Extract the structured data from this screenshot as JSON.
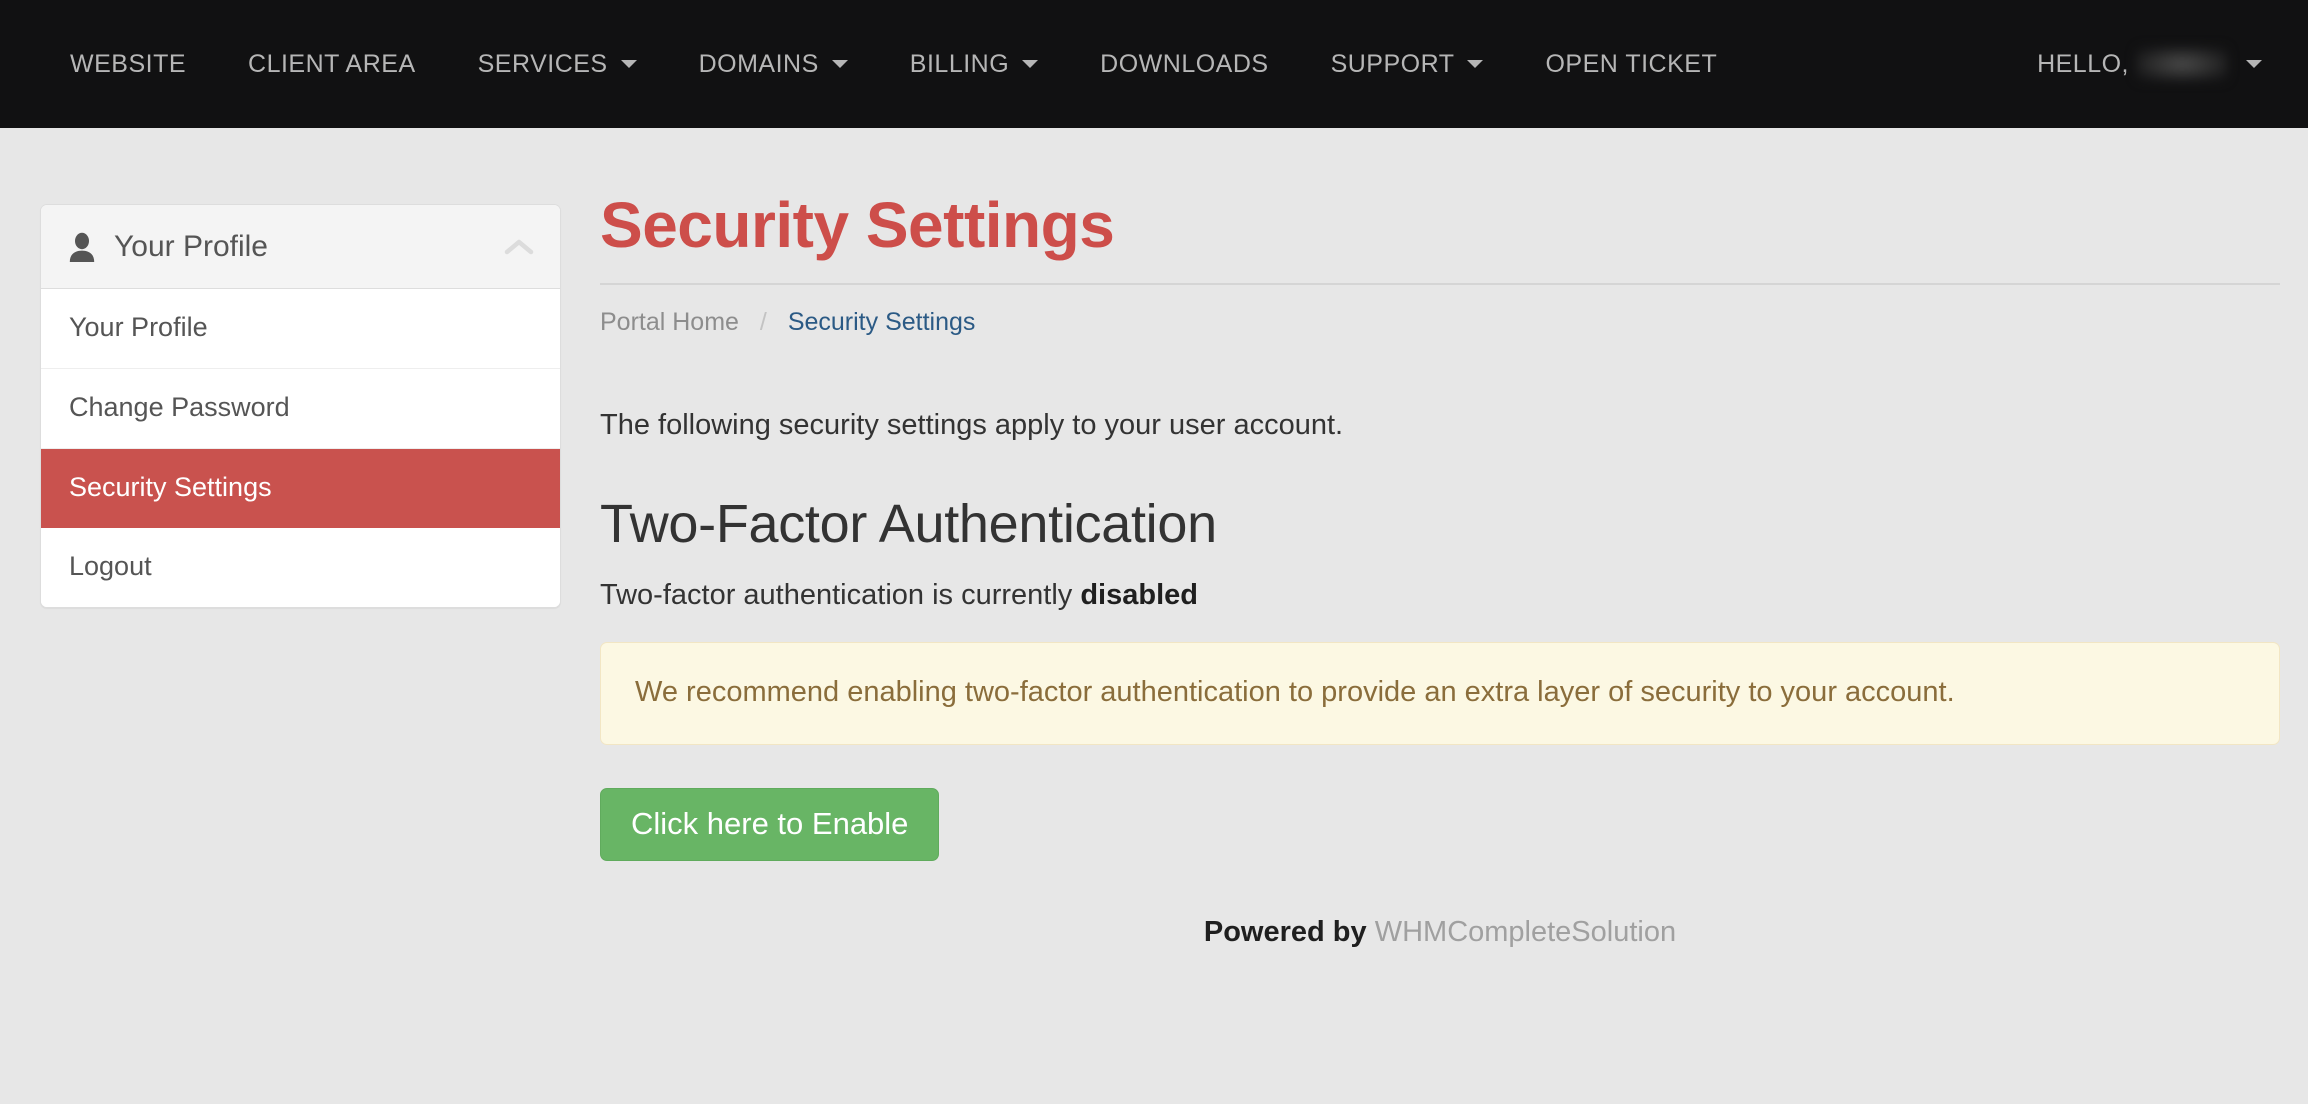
{
  "navbar": {
    "items": [
      {
        "label": "WEBSITE",
        "has_caret": false
      },
      {
        "label": "CLIENT AREA",
        "has_caret": false
      },
      {
        "label": "SERVICES",
        "has_caret": true
      },
      {
        "label": "DOMAINS",
        "has_caret": true
      },
      {
        "label": "BILLING",
        "has_caret": true
      },
      {
        "label": "DOWNLOADS",
        "has_caret": false
      },
      {
        "label": "SUPPORT",
        "has_caret": true
      },
      {
        "label": "OPEN TICKET",
        "has_caret": false
      }
    ],
    "account_greeting": "HELLO,",
    "account_name": "",
    "account_caret_icon": "caret-down-icon",
    "background_color": "#111112",
    "text_color": "#b6b6b6"
  },
  "sidebar": {
    "header": {
      "title": "Your Profile",
      "icon": "person-icon",
      "collapse_icon": "chevron-up-icon"
    },
    "items": [
      {
        "label": "Your Profile",
        "active": false
      },
      {
        "label": "Change Password",
        "active": false
      },
      {
        "label": "Security Settings",
        "active": true
      },
      {
        "label": "Logout",
        "active": false
      }
    ],
    "active_color": "#c9524e"
  },
  "main": {
    "title": "Security Settings",
    "title_color": "#cd4e4a",
    "breadcrumb": {
      "home": "Portal Home",
      "separator": "/",
      "current": "Security Settings"
    },
    "intro": "The following security settings apply to your user account.",
    "section": {
      "heading": "Two-Factor Authentication",
      "status_prefix": "Two-factor authentication is currently",
      "status_value": "disabled",
      "alert": "We recommend enabling two-factor authentication to provide an extra layer of security to your account.",
      "alert_bg_color": "#fcf8e3",
      "alert_text_color": "#8a6d3b",
      "enable_button_label": "Click here to Enable",
      "enable_button_color": "#68b565"
    }
  },
  "footer": {
    "powered_by": "Powered by",
    "brand": "WHMCompleteSolution"
  }
}
